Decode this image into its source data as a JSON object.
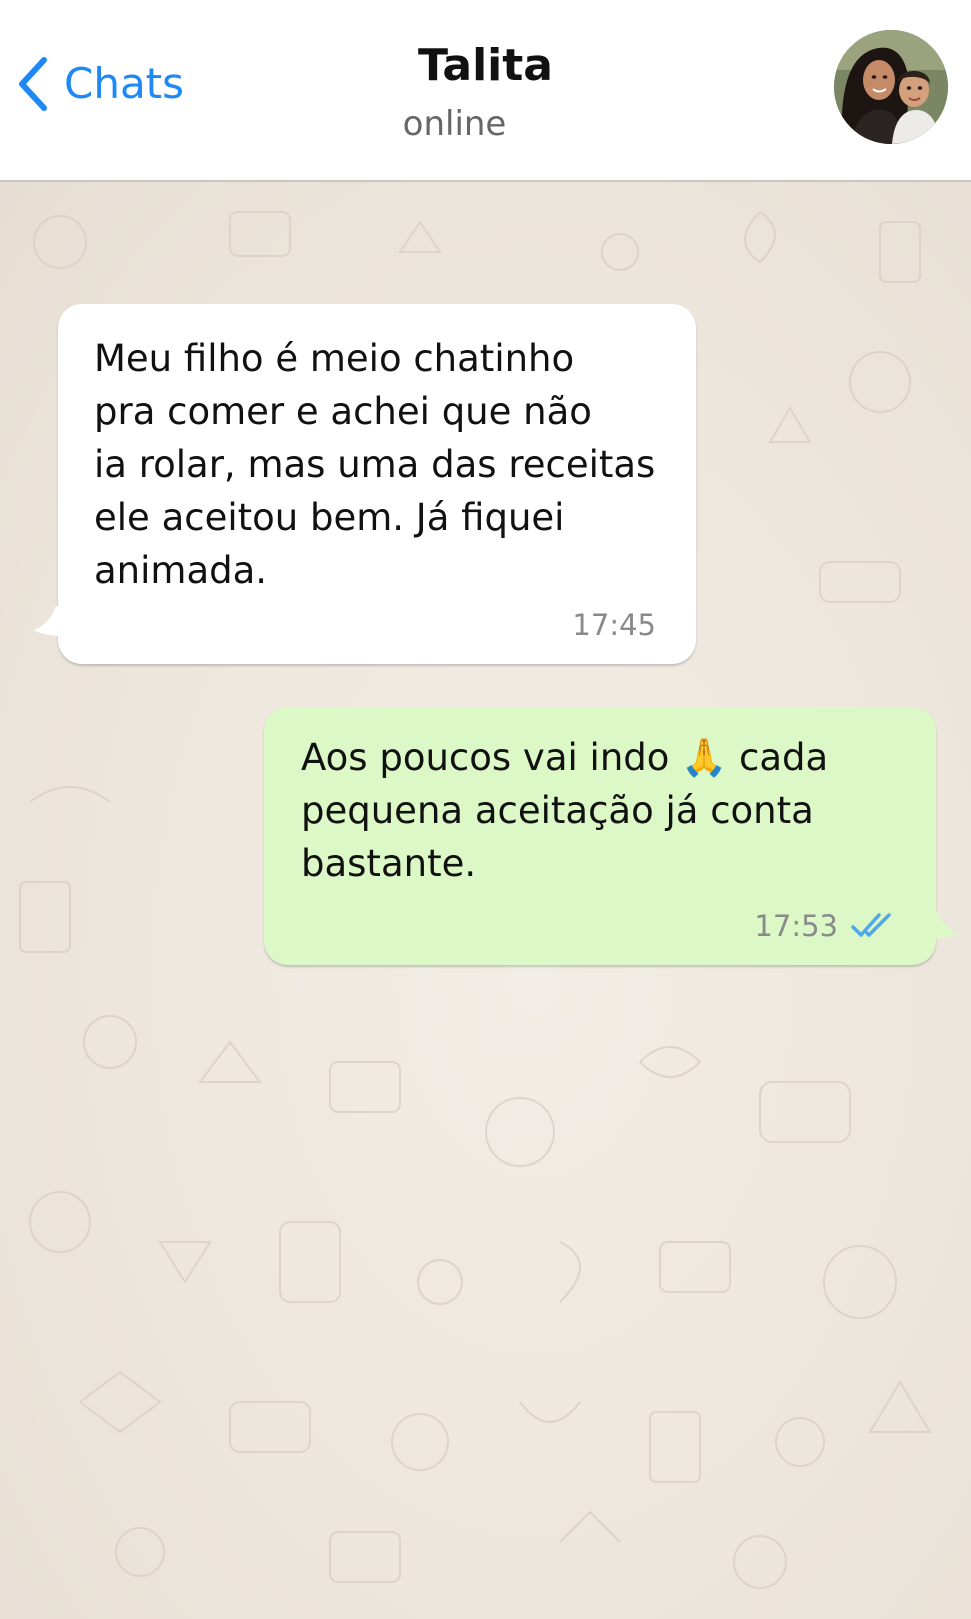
{
  "header": {
    "back_label": "Chats",
    "contact_name": "Talita",
    "status": "online",
    "back_icon": "chevron-left-icon",
    "avatar": "contact-avatar-photo"
  },
  "messages": [
    {
      "direction": "incoming",
      "text": "Meu filho é meio chatinho\npra comer e achei que não\nia rolar, mas uma das receitas\nele aceitou bem. Já fiquei\nanimada.",
      "time": "17:45"
    },
    {
      "direction": "outgoing",
      "text": "Aos poucos vai indo 🙏 cada\npequena aceitação já conta\nbastante.",
      "time": "17:53",
      "status_icon": "double-check-icon"
    }
  ],
  "colors": {
    "accent": "#1e88f5",
    "incoming_bubble": "#ffffff",
    "outgoing_bubble": "#dcf8c6",
    "wallpaper": "#ece5dd",
    "read_ticks": "#4fa9e8"
  }
}
